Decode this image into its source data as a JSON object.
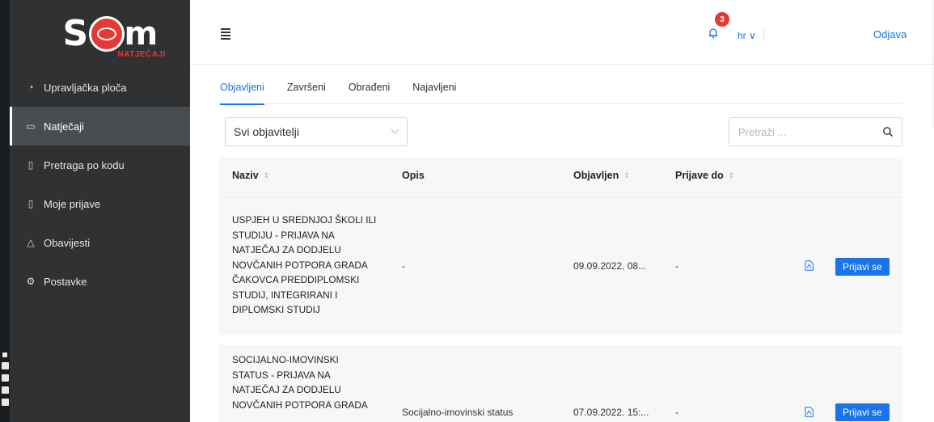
{
  "brand": {
    "logo_left": "S",
    "logo_right": "m",
    "logo_sub": "NATJEČAJI",
    "accent": "#e53935",
    "primary": "#1a73e8",
    "sidebar_bg": "#2f3133"
  },
  "sidebar": {
    "items": [
      {
        "label": "Upravljačka ploča",
        "icon": "dashboard-icon",
        "active": false
      },
      {
        "label": "Natječaji",
        "icon": "folder-icon",
        "active": true
      },
      {
        "label": "Pretraga po kodu",
        "icon": "document-search-icon",
        "active": false
      },
      {
        "label": "Moje prijave",
        "icon": "document-icon",
        "active": false
      },
      {
        "label": "Obavijesti",
        "icon": "bell-icon",
        "active": false
      },
      {
        "label": "Postavke",
        "icon": "gear-icon",
        "active": false
      }
    ]
  },
  "header": {
    "notification_count": "3",
    "language": "hr ∨",
    "logout": "Odjava"
  },
  "tabs": [
    {
      "label": "Objavljeni",
      "active": true
    },
    {
      "label": "Završeni",
      "active": false
    },
    {
      "label": "Obrađeni",
      "active": false
    },
    {
      "label": "Najavljeni",
      "active": false
    }
  ],
  "filters": {
    "publisher_selected": "Svi objavitelji",
    "search_placeholder": "Pretraži ..."
  },
  "table": {
    "columns": [
      "Naziv",
      "Opis",
      "Objavljen",
      "Prijave do"
    ],
    "rows": [
      {
        "title_lines": [
          "USPJEH U SREDNJOJ ŠKOLI ILI",
          "STUDIJU - PRIJAVA NA",
          "NATJEČAJ ZA DODJELU",
          "NOVČANIH POTPORA GRADA",
          "ČAKOVCA PREDDIPLOMSKI",
          "STUDIJ, INTEGRIRANI I",
          "DIPLOMSKI STUDIJ"
        ],
        "description": "-",
        "published": "09.09.2022. 08...",
        "deadline": "-",
        "apply_label": "Prijavi se"
      },
      {
        "title_lines": [
          "SOCIJALNO-IMOVINSKI",
          "STATUS - PRIJAVA NA",
          "NATJEČAJ ZA DODJELU",
          "NOVČANIH POTPORA GRADA"
        ],
        "description": "Socijalno-imovinski status",
        "published": "07.09.2022. 15:...",
        "deadline": "-",
        "apply_label": "Prijavi se"
      }
    ]
  }
}
